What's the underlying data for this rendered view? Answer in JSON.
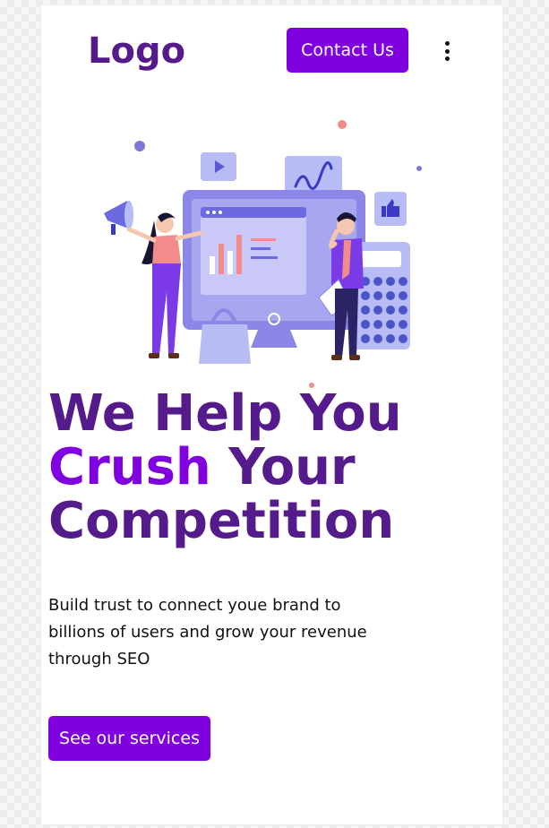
{
  "header": {
    "logo_text": "Logo",
    "contact_label": "Contact Us",
    "menu_icon": "kebab-menu-icon"
  },
  "hero": {
    "illustration": "digital-marketing-illustration",
    "headline_line1": "We Help You",
    "headline_accent": "Crush",
    "headline_line2_rest": " Your",
    "headline_line3": "Competition",
    "description": "Build trust to connect youe brand to billions of users and grow your revenue through SEO",
    "cta_label": "See our services"
  },
  "colors": {
    "brand_dark": "#551a8b",
    "brand_accent": "#8000e0",
    "button_bg": "#8000e0",
    "button_text": "#ffffff"
  }
}
